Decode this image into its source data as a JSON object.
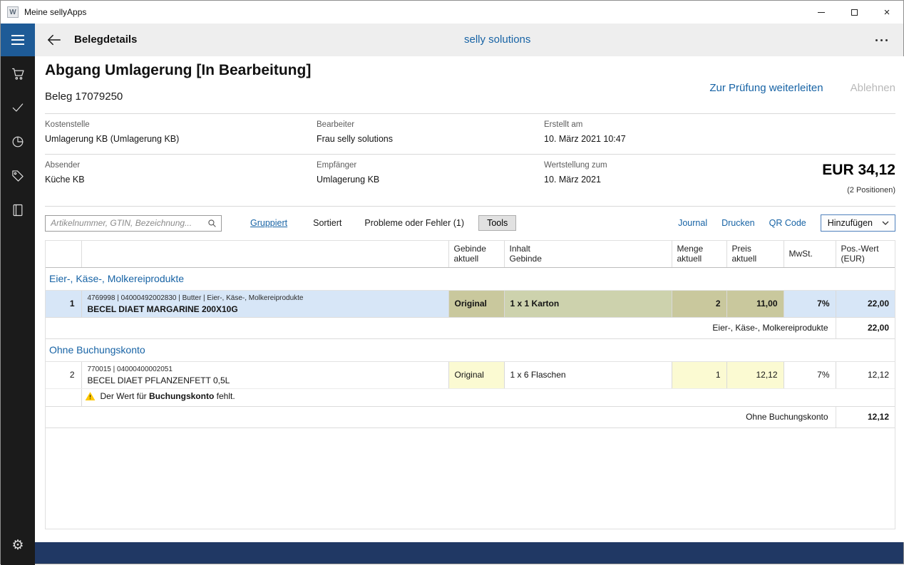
{
  "window": {
    "title": "Meine sellyApps"
  },
  "app_bar": {
    "title": "Belegdetails",
    "brand": "selly solutions"
  },
  "sidebar": {
    "icons": [
      "menu",
      "cart",
      "checkmark",
      "pie-chart",
      "tag",
      "book",
      "settings"
    ]
  },
  "colors": {
    "accent_blue": "#1763a5",
    "hamburger_blue": "#1e5b97",
    "bottom_bar_navy": "#203864",
    "selected_row": "#d7e6f7",
    "edited_cell_yellow": "#fbfad2",
    "edited_cell_selected_khaki": "#c9c89d",
    "warning_yellow": "#ffc800",
    "sidebar_dark": "#1b1b1b"
  },
  "document": {
    "title": "Abgang Umlagerung [In Bearbeitung]",
    "number": "Beleg 17079250",
    "action_forward": "Zur Prüfung weiterleiten",
    "action_reject": "Ablehnen",
    "fields": {
      "kostenstelle_label": "Kostenstelle",
      "kostenstelle": "Umlagerung KB (Umlagerung KB)",
      "bearbeiter_label": "Bearbeiter",
      "bearbeiter": "Frau selly solutions",
      "erstellt_label": "Erstellt am",
      "erstellt": "10. März 2021 10:47",
      "absender_label": "Absender",
      "absender": "Küche KB",
      "empfaenger_label": "Empfänger",
      "empfaenger": "Umlagerung KB",
      "wertstellung_label": "Wertstellung zum",
      "wertstellung": "10. März 2021"
    },
    "total": "EUR 34,12",
    "positions": "(2 Positionen)"
  },
  "toolbar": {
    "search_placeholder": "Artikelnummer, GTIN, Bezeichnung...",
    "grouped": "Gruppiert",
    "sorted": "Sortiert",
    "problems": "Probleme oder Fehler (1)",
    "tools": "Tools",
    "journal": "Journal",
    "print": "Drucken",
    "qr_code": "QR Code",
    "add": "Hinzufügen"
  },
  "table": {
    "columns": [
      "",
      "",
      "Gebinde\naktuell",
      "Inhalt\nGebinde",
      "Menge\naktuell",
      "Preis\naktuell",
      "MwSt.",
      "Pos.-Wert\n(EUR)"
    ],
    "groups": [
      {
        "name": "Eier-, Käse-, Molkereiprodukte",
        "rows": [
          {
            "pos": "1",
            "meta": "4769998 | 04000492002830 | Butter | Eier-, Käse-, Molkereiprodukte",
            "name": "BECEL DIAET MARGARINE 200X10G",
            "gebinde": "Original",
            "inhalt": "1 x 1 Karton",
            "menge": "2",
            "preis": "11,00",
            "mwst": "7%",
            "wert": "22,00"
          }
        ],
        "subtotal_label": "Eier-, Käse-, Molkereiprodukte",
        "subtotal_value": "22,00"
      },
      {
        "name": "Ohne Buchungskonto",
        "rows": [
          {
            "pos": "2",
            "meta": "770015 | 04000400002051",
            "name": "BECEL DIAET PFLANZENFETT 0,5L",
            "gebinde": "Original",
            "inhalt": "1 x 6 Flaschen",
            "menge": "1",
            "preis": "12,12",
            "mwst": "7%",
            "wert": "12,12",
            "warning_prefix": "Der Wert für ",
            "warning_bold": "Buchungskonto",
            "warning_suffix": " fehlt."
          }
        ],
        "subtotal_label": "Ohne Buchungskonto",
        "subtotal_value": "12,12"
      }
    ]
  }
}
